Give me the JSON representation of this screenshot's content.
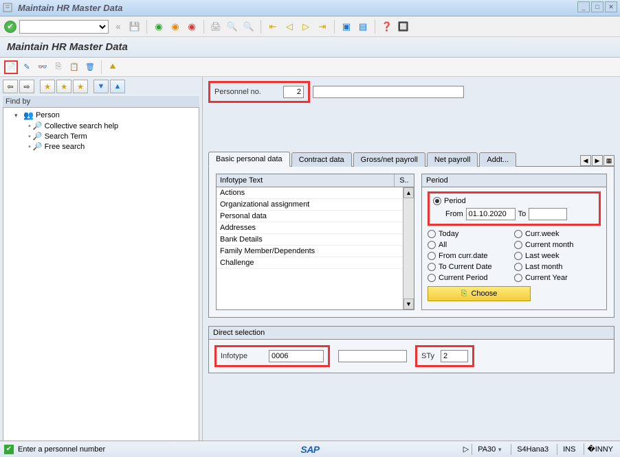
{
  "window": {
    "title": "Maintain HR Master Data"
  },
  "header": {
    "title": "Maintain HR Master Data"
  },
  "personnel": {
    "label": "Personnel no.",
    "value": "2"
  },
  "findby": {
    "label": "Find by"
  },
  "tree": {
    "root": "Person",
    "items": [
      "Collective search help",
      "Search Term",
      "Free search"
    ]
  },
  "tabs": [
    "Basic personal data",
    "Contract data",
    "Gross/net payroll",
    "Net payroll",
    "Addt..."
  ],
  "infotable": {
    "header1": "Infotype Text",
    "header2": "S..",
    "rows": [
      "Actions",
      "Organizational assignment",
      "Personal data",
      "Addresses",
      "Bank Details",
      "Family Member/Dependents",
      "Challenge"
    ]
  },
  "period": {
    "title": "Period",
    "period_label": "Period",
    "from_label": "From",
    "from_value": "01.10.2020",
    "to_label": "To",
    "to_value": "",
    "radios_left": [
      "Today",
      "All",
      "From curr.date",
      "To Current Date",
      "Current Period"
    ],
    "radios_right": [
      "Curr.week",
      "Current month",
      "Last week",
      "Last month",
      "Current Year"
    ],
    "choose": "Choose"
  },
  "direct": {
    "title": "Direct selection",
    "infotype_label": "Infotype",
    "infotype_value": "0006",
    "sty_label": "STy",
    "sty_value": "2"
  },
  "status": {
    "message": "Enter a personnel number",
    "tcode": "PA30",
    "system": "S4Hana3",
    "mode": "INS"
  }
}
